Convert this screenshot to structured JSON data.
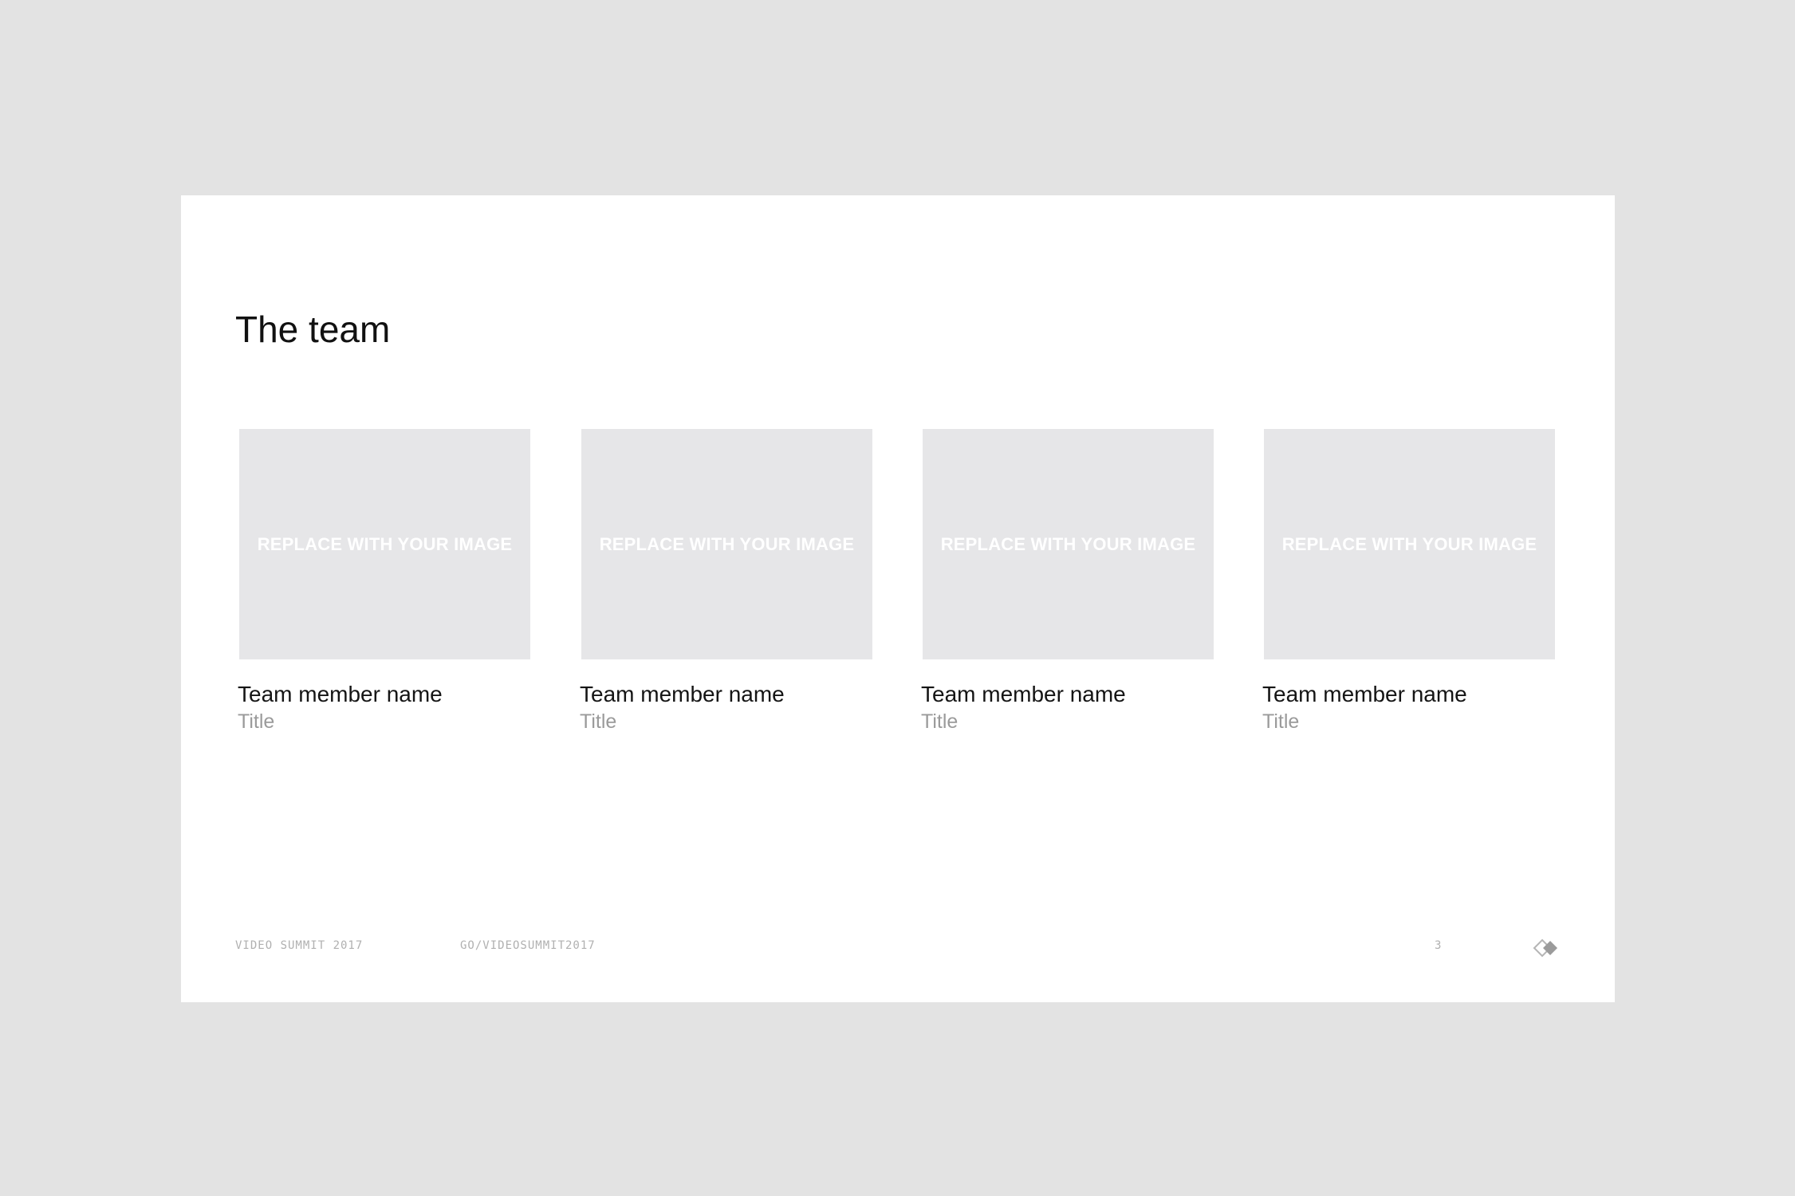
{
  "slide": {
    "title": "The team",
    "image_placeholder": "REPLACE WITH YOUR IMAGE",
    "members": [
      {
        "name": "Team member name",
        "title": "Title"
      },
      {
        "name": "Team member name",
        "title": "Title"
      },
      {
        "name": "Team member name",
        "title": "Title"
      },
      {
        "name": "Team member name",
        "title": "Title"
      }
    ],
    "footer": {
      "event": "VIDEO SUMMIT 2017",
      "link": "GO/VIDEOSUMMIT2017",
      "page_number": "3",
      "logo_icon": "diamond-logo-icon"
    }
  },
  "colors": {
    "background": "#e3e3e3",
    "slide": "#ffffff",
    "placeholder": "#e6e6e8",
    "title_text": "#111111",
    "secondary_text": "#9a9a9a",
    "footer_text": "#b0b0b0"
  }
}
